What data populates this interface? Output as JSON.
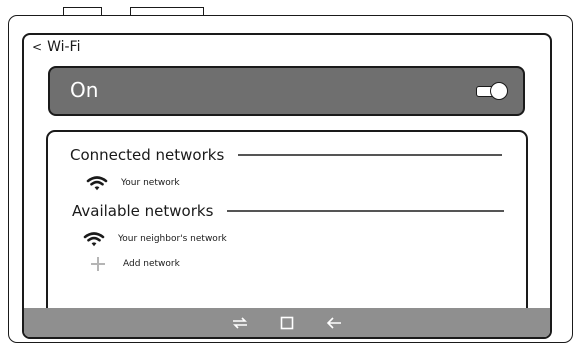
{
  "header": {
    "back_icon": "chevron-left-icon",
    "back_glyph": "<",
    "title": "Wi-Fi"
  },
  "wifi_toggle": {
    "label": "On",
    "state": "on"
  },
  "connected": {
    "title": "Connected networks",
    "items": [
      {
        "name": "Your network",
        "icon": "wifi-icon"
      }
    ]
  },
  "available": {
    "title": "Available networks",
    "items": [
      {
        "name": "Your neighbor's network",
        "icon": "wifi-icon"
      }
    ],
    "add_label": "Add network",
    "add_icon": "plus-icon"
  },
  "navbar": {
    "icons": [
      "recents-icon",
      "home-icon",
      "back-arrow-icon"
    ]
  },
  "colors": {
    "bar": "#6f6f6f",
    "navbar": "#8f8f8f",
    "outline": "#1a1a1a",
    "text_on_bar": "#ffffff",
    "plus": "#b5b5b5"
  }
}
